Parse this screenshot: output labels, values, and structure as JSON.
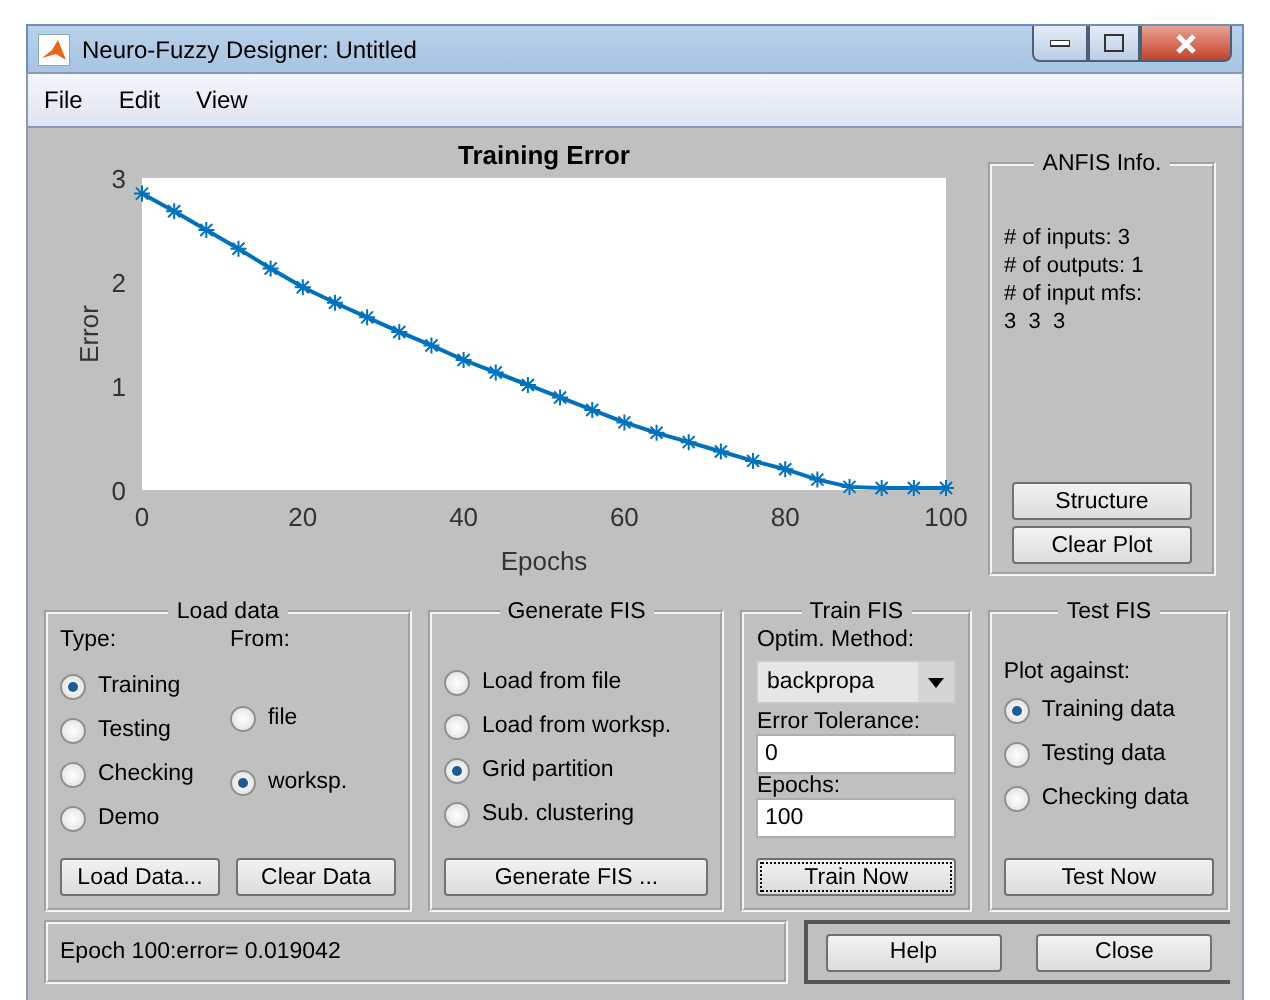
{
  "window": {
    "title": "Neuro-Fuzzy Designer: Untitled"
  },
  "menu": [
    "File",
    "Edit",
    "View"
  ],
  "chart_data": {
    "type": "line",
    "title": "Training Error",
    "xlabel": "Epochs",
    "ylabel": "Error",
    "xlim": [
      0,
      100
    ],
    "ylim": [
      0,
      3
    ],
    "xticks": [
      0,
      20,
      40,
      60,
      80,
      100
    ],
    "yticks": [
      0,
      1,
      2,
      3
    ],
    "x": [
      0,
      4,
      8,
      12,
      16,
      20,
      24,
      28,
      32,
      36,
      40,
      44,
      48,
      52,
      56,
      60,
      64,
      68,
      72,
      76,
      80,
      84,
      88,
      92,
      96,
      100
    ],
    "series": [
      {
        "color": "#0072bd",
        "marker": "cross",
        "values": [
          2.85,
          2.68,
          2.5,
          2.32,
          2.13,
          1.95,
          1.8,
          1.66,
          1.52,
          1.39,
          1.25,
          1.13,
          1.01,
          0.89,
          0.77,
          0.65,
          0.55,
          0.46,
          0.37,
          0.28,
          0.2,
          0.1,
          0.03,
          0.02,
          0.02,
          0.02
        ]
      }
    ]
  },
  "anfis_info": {
    "title": "ANFIS Info.",
    "lines": [
      "# of inputs: 3",
      "# of outputs: 1",
      "# of input mfs:",
      "3  3  3"
    ],
    "buttons": [
      "Structure",
      "Clear Plot"
    ]
  },
  "load_data": {
    "title": "Load data",
    "type_label": "Type:",
    "from_label": "From:",
    "types": [
      {
        "label": "Training",
        "selected": true
      },
      {
        "label": "Testing",
        "selected": false
      },
      {
        "label": "Checking",
        "selected": false
      },
      {
        "label": "Demo",
        "selected": false
      }
    ],
    "sources": [
      {
        "label": "file",
        "selected": false
      },
      {
        "label": "worksp.",
        "selected": true
      }
    ],
    "buttons": [
      "Load Data...",
      "Clear Data"
    ]
  },
  "generate_fis": {
    "title": "Generate FIS",
    "options": [
      {
        "label": "Load from file",
        "selected": false
      },
      {
        "label": "Load from worksp.",
        "selected": false
      },
      {
        "label": "Grid partition",
        "selected": true
      },
      {
        "label": "Sub. clustering",
        "selected": false
      }
    ],
    "button": "Generate FIS ..."
  },
  "train_fis": {
    "title": "Train FIS",
    "method_label": "Optim. Method:",
    "method": "backpropa",
    "tolerance_label": "Error Tolerance:",
    "tolerance": "0",
    "epochs_label": "Epochs:",
    "epochs": "100",
    "button": {
      "label": "Train Now",
      "focused": true
    }
  },
  "test_fis": {
    "title": "Test FIS",
    "plot_label": "Plot against:",
    "options": [
      {
        "label": "Training data",
        "selected": true
      },
      {
        "label": "Testing data",
        "selected": false
      },
      {
        "label": "Checking data",
        "selected": false
      }
    ],
    "button": "Test Now"
  },
  "status": "Epoch 100:error= 0.019042",
  "footer_buttons": [
    "Help",
    "Close"
  ]
}
